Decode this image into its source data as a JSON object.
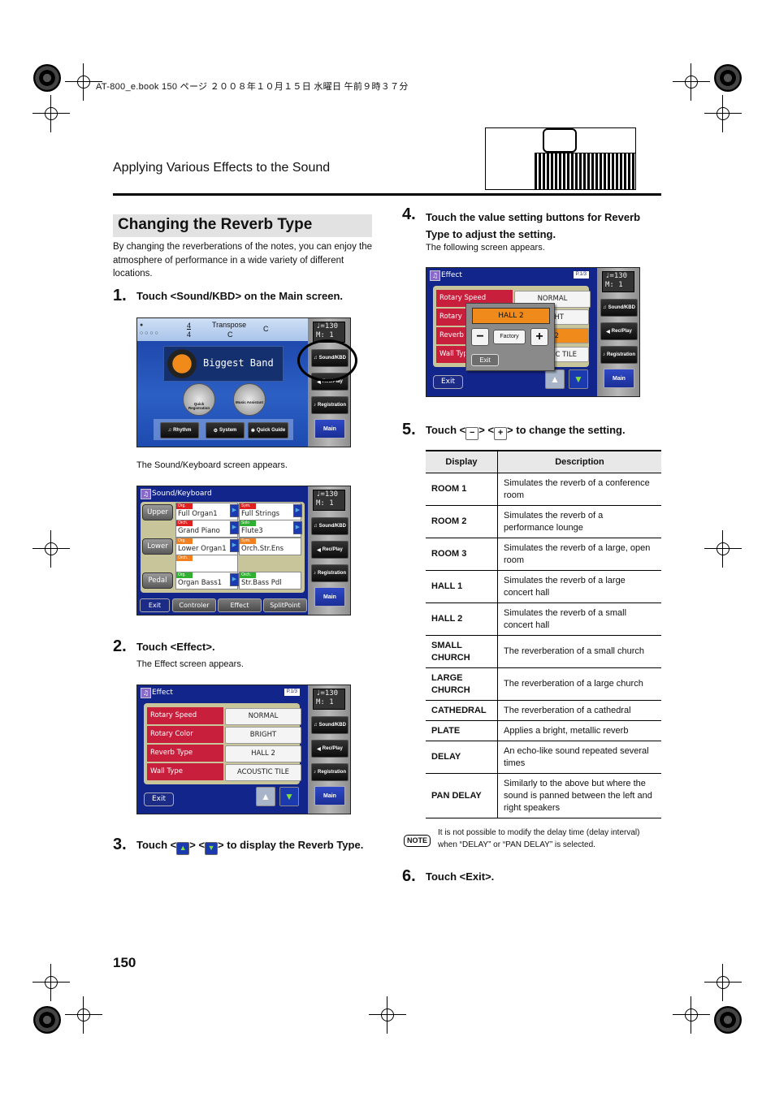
{
  "print_header": "AT-800_e.book  150 ページ  ２００８年１０月１５日  水曜日  午前９時３７分",
  "section_title": "Applying Various Effects to the Sound",
  "heading": "Changing the Reverb Type",
  "intro": "By changing the reverberations of the notes, you can enjoy the atmosphere of performance in a wide variety of different locations.",
  "page_number": "150",
  "steps": [
    {
      "num": "1.",
      "text": "Touch <Sound/KBD> on the Main screen."
    },
    {
      "num": "2.",
      "text": "Touch <Effect>."
    },
    {
      "num": "3.",
      "text_before": "Touch <",
      "text_mid": "> <",
      "text_after": "> to display the Reverb Type."
    },
    {
      "num": "4.",
      "text": "Touch the value setting buttons for Reverb Type to adjust the setting."
    },
    {
      "num": "5.",
      "text_before": "Touch <",
      "text_mid": "> <",
      "text_after": "> to change the setting."
    },
    {
      "num": "6.",
      "text": "Touch <Exit>."
    }
  ],
  "captions": {
    "after_main": "The Sound/Keyboard screen appears.",
    "after_step2": "The Effect screen appears.",
    "after_step4": "The following screen appears."
  },
  "side_panel": {
    "tempo": "♩=130",
    "measure": "M:   1",
    "sound_kbd": "Sound/KBD",
    "rec_play": "Rec/Play",
    "registration": "Registration",
    "main": "Main"
  },
  "main_screen": {
    "time_sig_top": "4",
    "time_sig_bottom": "4",
    "transpose_label": "Transpose",
    "transpose_value": "C",
    "key": "C",
    "rhythm_name": "Biggest Band",
    "quick_registration": "Quick Registration",
    "music_assistant": "Music Assistant",
    "buttons": [
      "Rhythm",
      "System",
      "Quick Guide"
    ]
  },
  "sound_kbd_screen": {
    "title": "Sound/Keyboard",
    "parts": [
      "Upper",
      "Lower",
      "Pedal"
    ],
    "tones": [
      {
        "tag": "Org.",
        "tag_color": "#e02020",
        "name": "Full Organ1"
      },
      {
        "tag": "Sym.",
        "tag_color": "#e02020",
        "name": "Full Strings"
      },
      {
        "tag": "Orch.",
        "tag_color": "#e02020",
        "name": "Grand Piano"
      },
      {
        "tag": "Solo",
        "tag_color": "#30b030",
        "name": "Flute3"
      },
      {
        "tag": "Org.",
        "tag_color": "#f08020",
        "name": "Lower Organ1"
      },
      {
        "tag": "Sym.",
        "tag_color": "#f08020",
        "name": "Orch.Str.Ens"
      },
      {
        "tag": "Orch.",
        "tag_color": "#f08020",
        "name": ""
      },
      {
        "tag": "Org.",
        "tag_color": "#30b030",
        "name": "Organ Bass1"
      },
      {
        "tag": "Orch.",
        "tag_color": "#30b030",
        "name": "Str.Bass Pdl"
      }
    ],
    "bottom_buttons": [
      "Exit",
      "Controler",
      "Effect",
      "SplitPoint"
    ]
  },
  "effect_screen": {
    "title": "Effect",
    "page": "P.1/3",
    "rows": [
      {
        "label": "Rotary Speed",
        "value": "NORMAL"
      },
      {
        "label": "Rotary Color",
        "value": "BRIGHT"
      },
      {
        "label": "Reverb Type",
        "value": "HALL 2"
      },
      {
        "label": "Wall Type",
        "value": "ACOUSTIC TILE"
      }
    ],
    "exit": "Exit",
    "up_icon": "▲",
    "down_icon": "▼"
  },
  "value_popup": {
    "value": "HALL 2",
    "minus": "−",
    "factory": "Factory",
    "plus": "+",
    "exit": "Exit",
    "bg_rows": [
      {
        "label": "Rotary Speed",
        "value": "NORMAL"
      },
      {
        "label": "Rotary",
        "value": "HT"
      },
      {
        "label": "Reverb",
        "value": "2"
      },
      {
        "label": "Wall Typ",
        "value": "C TILE"
      }
    ]
  },
  "reverb_table": {
    "headers": [
      "Display",
      "Description"
    ],
    "rows": [
      [
        "ROOM 1",
        "Simulates the reverb of a conference room"
      ],
      [
        "ROOM 2",
        "Simulates the reverb of a performance lounge"
      ],
      [
        "ROOM 3",
        "Simulates the reverb of a large, open room"
      ],
      [
        "HALL 1",
        "Simulates the reverb of a large concert hall"
      ],
      [
        "HALL 2",
        "Simulates the reverb of a small concert hall"
      ],
      [
        "SMALL CHURCH",
        "The reverberation of a small church"
      ],
      [
        "LARGE CHURCH",
        "The reverberation of a large church"
      ],
      [
        "CATHEDRAL",
        "The reverberation of a cathedral"
      ],
      [
        "PLATE",
        "Applies a bright, metallic reverb"
      ],
      [
        "DELAY",
        "An echo-like sound repeated several times"
      ],
      [
        "PAN DELAY",
        "Similarly to the above but where the sound is panned between the left and right speakers"
      ]
    ]
  },
  "note": {
    "badge": "NOTE",
    "text": "It is not possible to modify the delay time (delay interval) when “DELAY” or “PAN DELAY” is selected."
  },
  "colors": {
    "accent_red": "#c8203c",
    "screen_blue": "#12258a",
    "popup_orange": "#f08a1a"
  }
}
